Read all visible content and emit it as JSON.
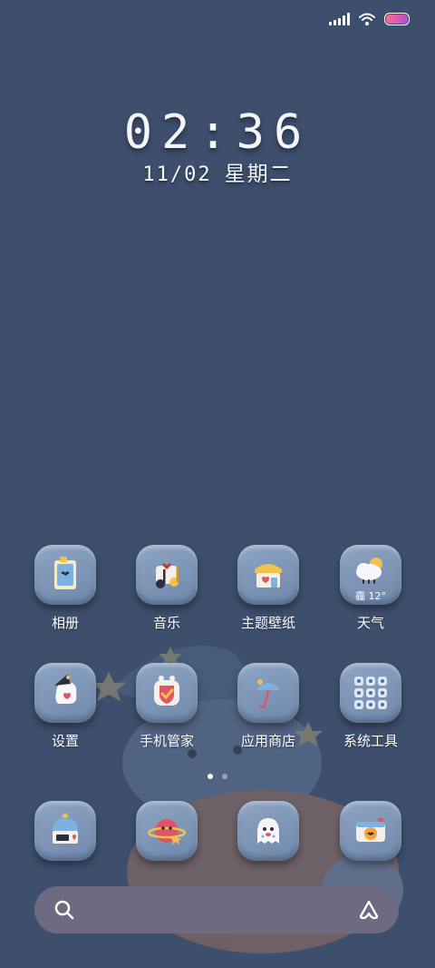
{
  "status_bar": {
    "signal_icon": "cellular-signal-icon",
    "wifi_icon": "wifi-icon",
    "battery_icon": "battery-icon"
  },
  "clock": {
    "time": "02:36",
    "date": "11/02",
    "weekday": "星期二"
  },
  "apps_row1": [
    {
      "label": "相册",
      "icon": "photo-album-icon"
    },
    {
      "label": "音乐",
      "icon": "music-note-icon"
    },
    {
      "label": "主题壁纸",
      "icon": "theme-shop-icon"
    },
    {
      "label": "天气",
      "icon": "weather-cloud-icon",
      "extra": "霾 12°"
    }
  ],
  "apps_row2": [
    {
      "label": "设置",
      "icon": "settings-ghost-icon"
    },
    {
      "label": "手机管家",
      "icon": "security-shield-icon"
    },
    {
      "label": "应用商店",
      "icon": "umbrella-icon"
    },
    {
      "label": "系统工具",
      "icon": "folder-icon"
    }
  ],
  "dock": [
    {
      "icon": "phone-house-icon"
    },
    {
      "icon": "browser-planet-icon"
    },
    {
      "icon": "messages-ghost-icon"
    },
    {
      "icon": "camera-icon"
    }
  ],
  "page_indicator": {
    "count": 2,
    "active": 0
  },
  "search_bar": {
    "search_icon": "search-icon",
    "assistant_icon": "assistant-icon"
  },
  "colors": {
    "background": "#3d4f6d",
    "tile": "#7f97b8",
    "search": "#6d6a82"
  }
}
